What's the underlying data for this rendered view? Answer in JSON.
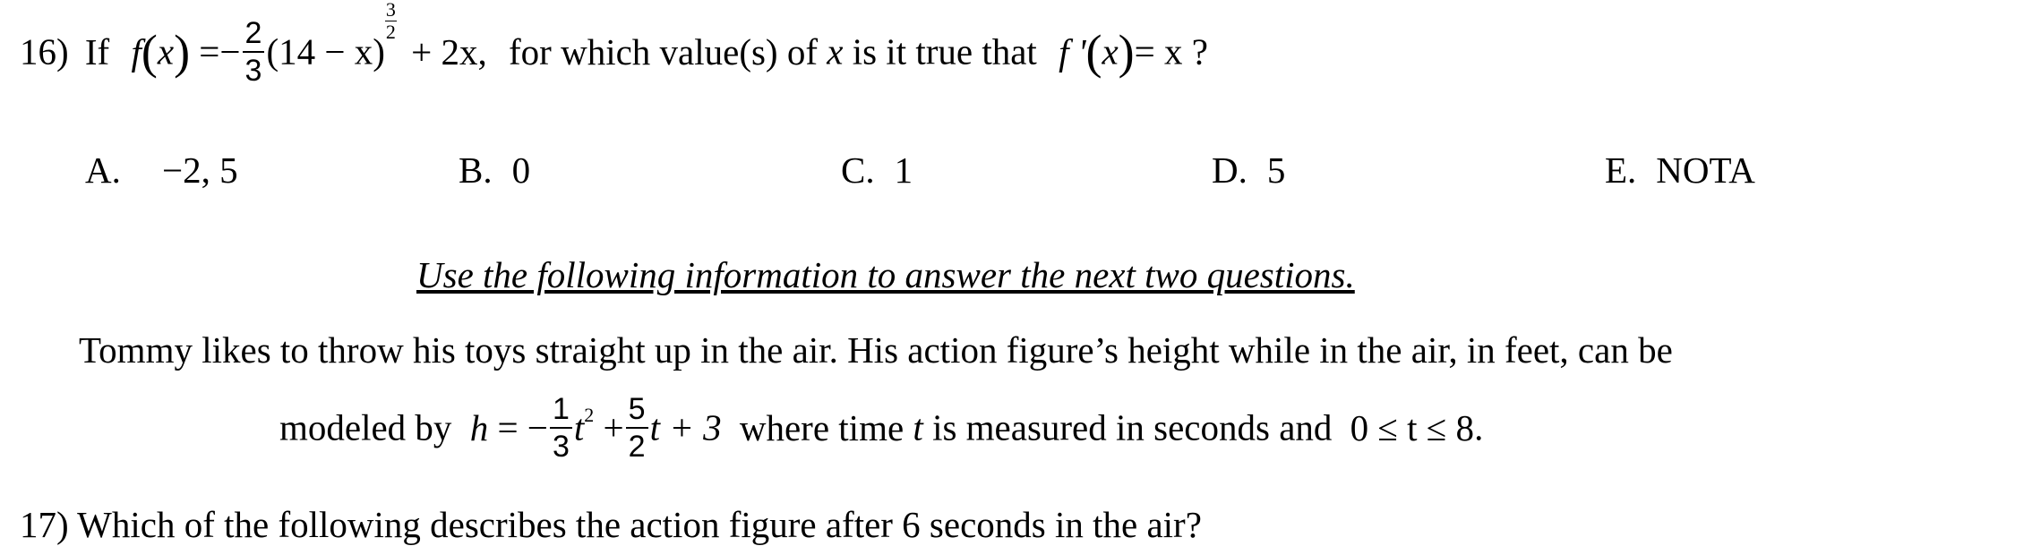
{
  "question16": {
    "number": "16)",
    "lead": "If",
    "f_label": "f",
    "var_x": "x",
    "equals": "=",
    "minus": "−",
    "coef_num": "2",
    "coef_den": "3",
    "inner_text": "(14 − x)",
    "exp_num": "3",
    "exp_den": "2",
    "plus_2x": "+ 2x,",
    "middle_text": "for which value(s) of",
    "var_x2": "x",
    "tail_text": "is it true that",
    "fprime": "f '",
    "rhs": "= x ?"
  },
  "choices": [
    {
      "letter": "A.",
      "value": "−2, 5"
    },
    {
      "letter": "B.",
      "value": "0"
    },
    {
      "letter": "C.",
      "value": "1"
    },
    {
      "letter": "D.",
      "value": "5"
    },
    {
      "letter": "E.",
      "value": "NOTA"
    }
  ],
  "info_heading": "Use the following information to answer the next two questions.",
  "paragraph": {
    "line1": "Tommy likes to throw his toys straight up in the air. His action figure’s height while in the air, in feet, can be",
    "line2_lead": "modeled by",
    "h": "h",
    "eq": "= −",
    "c1_num": "1",
    "c1_den": "3",
    "t_sq": "t",
    "sq": "2",
    "plus": "+",
    "c2_num": "5",
    "c2_den": "2",
    "t_lin": "t + 3",
    "where_text": "where time",
    "t_var": "t",
    "measured_text": "is measured in seconds and",
    "range": "0 ≤ t ≤ 8",
    "period": "."
  },
  "question17_partial": "17) Which of the following describes the action figure after 6 seconds in the air?"
}
